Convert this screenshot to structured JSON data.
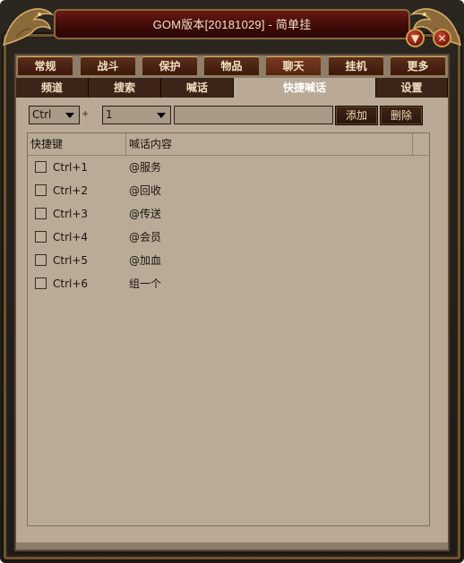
{
  "window": {
    "title": "GOM版本[20181029] - 简单挂",
    "minimize_icon": "chevron-down-icon",
    "close_icon": "close-icon"
  },
  "main_tabs": [
    {
      "label": "常规",
      "active": false
    },
    {
      "label": "战斗",
      "active": false
    },
    {
      "label": "保护",
      "active": false
    },
    {
      "label": "物品",
      "active": false
    },
    {
      "label": "聊天",
      "active": true
    },
    {
      "label": "挂机",
      "active": false
    },
    {
      "label": "更多",
      "active": false
    }
  ],
  "sub_tabs": [
    {
      "label": "频道",
      "active": false
    },
    {
      "label": "搜索",
      "active": false
    },
    {
      "label": "喊话",
      "active": false
    },
    {
      "label": "快捷喊话",
      "active": true
    },
    {
      "label": "设置",
      "active": false
    }
  ],
  "toolbar": {
    "modifier_value": "Ctrl",
    "plus": "+",
    "key_value": "1",
    "text_value": "",
    "add_label": "添加",
    "delete_label": "删除"
  },
  "table": {
    "columns": [
      "快捷键",
      "喊话内容"
    ],
    "rows": [
      {
        "checked": false,
        "key": "Ctrl+1",
        "text": "@服务"
      },
      {
        "checked": false,
        "key": "Ctrl+2",
        "text": "@回收"
      },
      {
        "checked": false,
        "key": "Ctrl+3",
        "text": "@传送"
      },
      {
        "checked": false,
        "key": "Ctrl+4",
        "text": "@会员"
      },
      {
        "checked": false,
        "key": "Ctrl+5",
        "text": "@加血"
      },
      {
        "checked": false,
        "key": "Ctrl+6",
        "text": "组一个"
      }
    ]
  },
  "colors": {
    "title_bar": "#3d0a08",
    "gold_trim": "#c9a04a",
    "content_bg": "#baa996",
    "tab_bg": "#3d2418"
  }
}
